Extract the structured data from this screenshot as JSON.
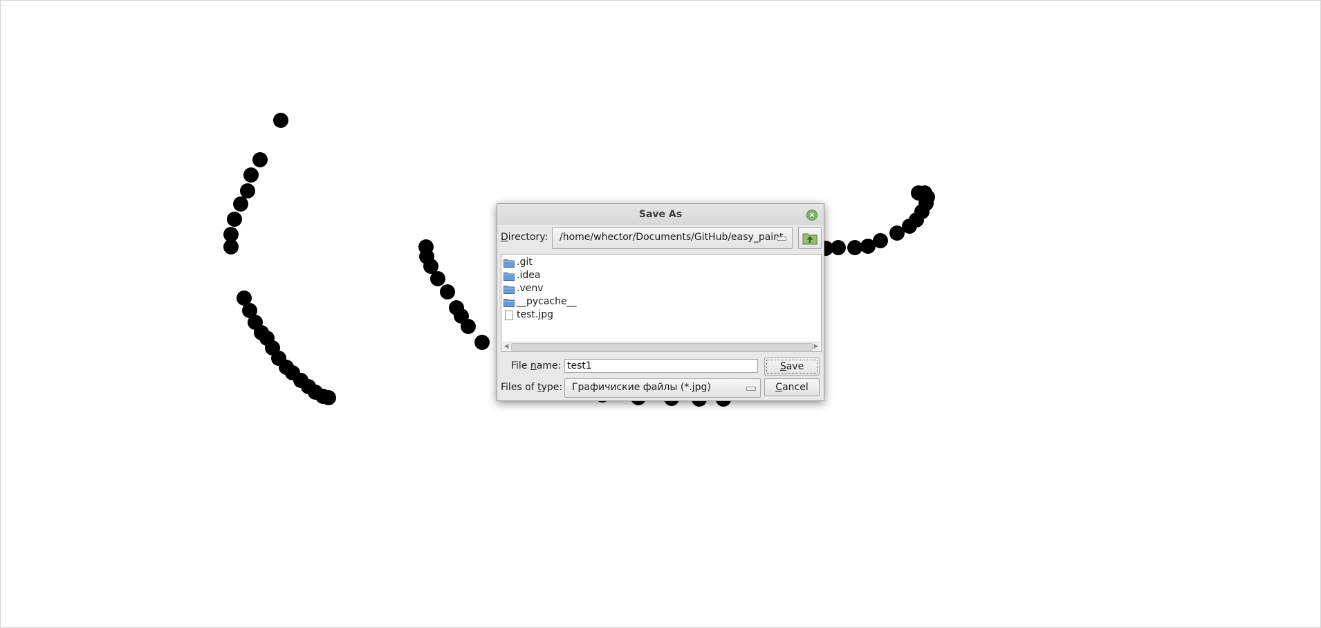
{
  "dialog": {
    "title": "Save As",
    "directory_label": "Directory:",
    "directory_value": "/home/whector/Documents/GitHub/easy_paint",
    "files": [
      {
        "name": ".git",
        "type": "folder"
      },
      {
        "name": ".idea",
        "type": "folder"
      },
      {
        "name": ".venv",
        "type": "folder"
      },
      {
        "name": "__pycache__",
        "type": "folder"
      },
      {
        "name": "test.jpg",
        "type": "file"
      }
    ],
    "file_name_label": "File name:",
    "file_name_value": "test1",
    "files_of_type_label": "Files of type:",
    "files_of_type_value": "Графичиские файлы (*.jpg)",
    "save_label": "Save",
    "cancel_label": "Cancel"
  },
  "icons": {
    "close": "close-icon",
    "up_folder": "up-folder-icon",
    "folder": "folder-icon",
    "file": "file-icon"
  },
  "colors": {
    "ink": "#000000",
    "canvas": "#ffffff",
    "dialog_bg": "#e8e8e8",
    "close_button": "#7fb266"
  }
}
